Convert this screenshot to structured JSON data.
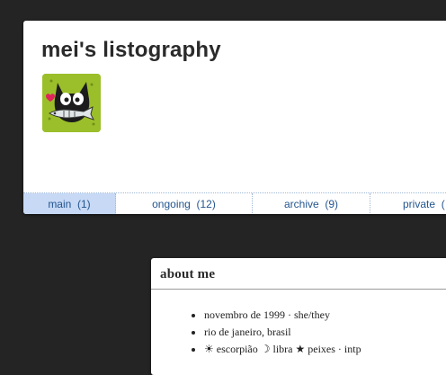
{
  "header": {
    "title": "mei's listography"
  },
  "avatar": {
    "icon": "cat-holding-fish-icon",
    "colors": {
      "background": "#9bbf2a",
      "cat": "#1c1c1c",
      "heart": "#e0245e"
    }
  },
  "tabs": [
    {
      "label": "main",
      "count": "(1)",
      "active": true
    },
    {
      "label": "ongoing",
      "count": "(12)",
      "active": false
    },
    {
      "label": "archive",
      "count": "(9)",
      "active": false
    },
    {
      "label": "private",
      "count": "(",
      "active": false
    }
  ],
  "about": {
    "title": "about me",
    "items": [
      "novembro de 1999 · she/they",
      "rio de janeiro, brasil",
      "☀ escorpião ☽ libra ★ peixes · intp"
    ]
  },
  "colors": {
    "page_background": "#242424",
    "tab_active": "#c7d9f5",
    "tab_text": "#24568f"
  }
}
